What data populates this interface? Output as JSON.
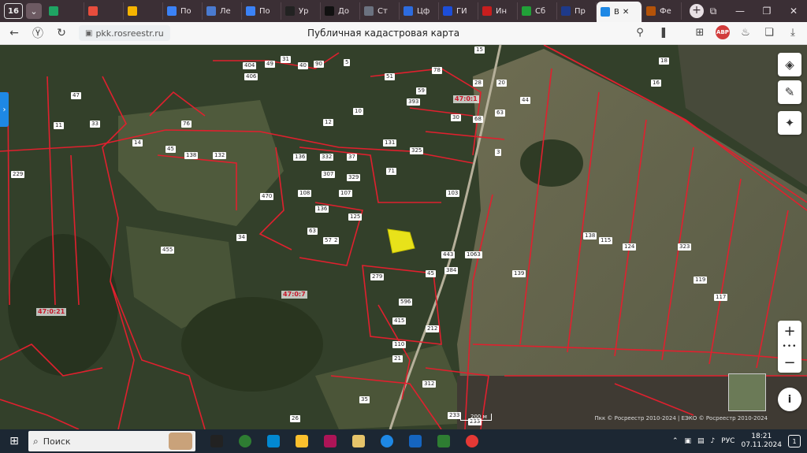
{
  "tabbar": {
    "counter": "16",
    "tabs": [
      {
        "label": "",
        "color": "#1fa463"
      },
      {
        "label": "",
        "color": "#e84d3d"
      },
      {
        "label": "",
        "color": "#f5b400"
      },
      {
        "label": "По",
        "color": "#3b82f6"
      },
      {
        "label": "Ле",
        "color": "#4a7bd0"
      },
      {
        "label": "По",
        "color": "#3b82f6"
      },
      {
        "label": "Ур",
        "color": "#222222"
      },
      {
        "label": "До",
        "color": "#111111"
      },
      {
        "label": "Ст",
        "color": "#6b7280"
      },
      {
        "label": "Цф",
        "color": "#2d6cdf"
      },
      {
        "label": "ГИ",
        "color": "#1d4ed8"
      },
      {
        "label": "Ин",
        "color": "#c81e1e"
      },
      {
        "label": "Сб",
        "color": "#21a038"
      },
      {
        "label": "Пр",
        "color": "#1e3a8a"
      }
    ],
    "active_tab": {
      "label": "В",
      "close": "✕"
    },
    "after_tabs": [
      {
        "label": "Фе",
        "color": "#b45309"
      }
    ],
    "new_tab": "+"
  },
  "navbar": {
    "url": "pkk.rosreestr.ru",
    "title": "Публичная кадастровая карта",
    "abp": "ABP"
  },
  "map": {
    "quarter_labels": [
      {
        "text": "47:0:1",
        "pos": "a"
      },
      {
        "text": "47:0:7",
        "pos": "b"
      },
      {
        "text": "47:0:21",
        "pos": "c"
      }
    ],
    "parcels": [
      "404",
      "406",
      "49",
      "31",
      "40",
      "90",
      "5",
      "51",
      "78",
      "15",
      "18",
      "16",
      "28",
      "20",
      "59",
      "393",
      "44",
      "30",
      "68",
      "63",
      "10",
      "12",
      "11",
      "33",
      "47",
      "76",
      "14",
      "45",
      "138",
      "132",
      "136",
      "332",
      "37",
      "131",
      "325",
      "3",
      "307",
      "329",
      "71",
      "103",
      "108",
      "107",
      "136",
      "125",
      "2",
      "63",
      "57",
      "455",
      "470",
      "34",
      "279",
      "596",
      "415",
      "45",
      "443",
      "1063",
      "384",
      "139",
      "138",
      "115",
      "124",
      "323",
      "119",
      "117",
      "110",
      "212",
      "21",
      "312",
      "35",
      "233",
      "233",
      "26",
      "229"
    ],
    "scale": "200 м",
    "copyright": "Пкк © Росреестр 2010-2024 | ЕЭКО © Росреестр 2010-2024",
    "zoom_in": "+",
    "zoom_out": "−",
    "zoom_dots": "•••",
    "info": "i",
    "side_tab": "›"
  },
  "taskbar": {
    "search_placeholder": "Поиск",
    "lang": "РУС",
    "time": "18:21",
    "date": "07.11.2024",
    "notifications": "1"
  },
  "colors": {
    "boundary": "#e0202e",
    "selected_parcel": "#e8e21a",
    "accent": "#1e88e5"
  }
}
